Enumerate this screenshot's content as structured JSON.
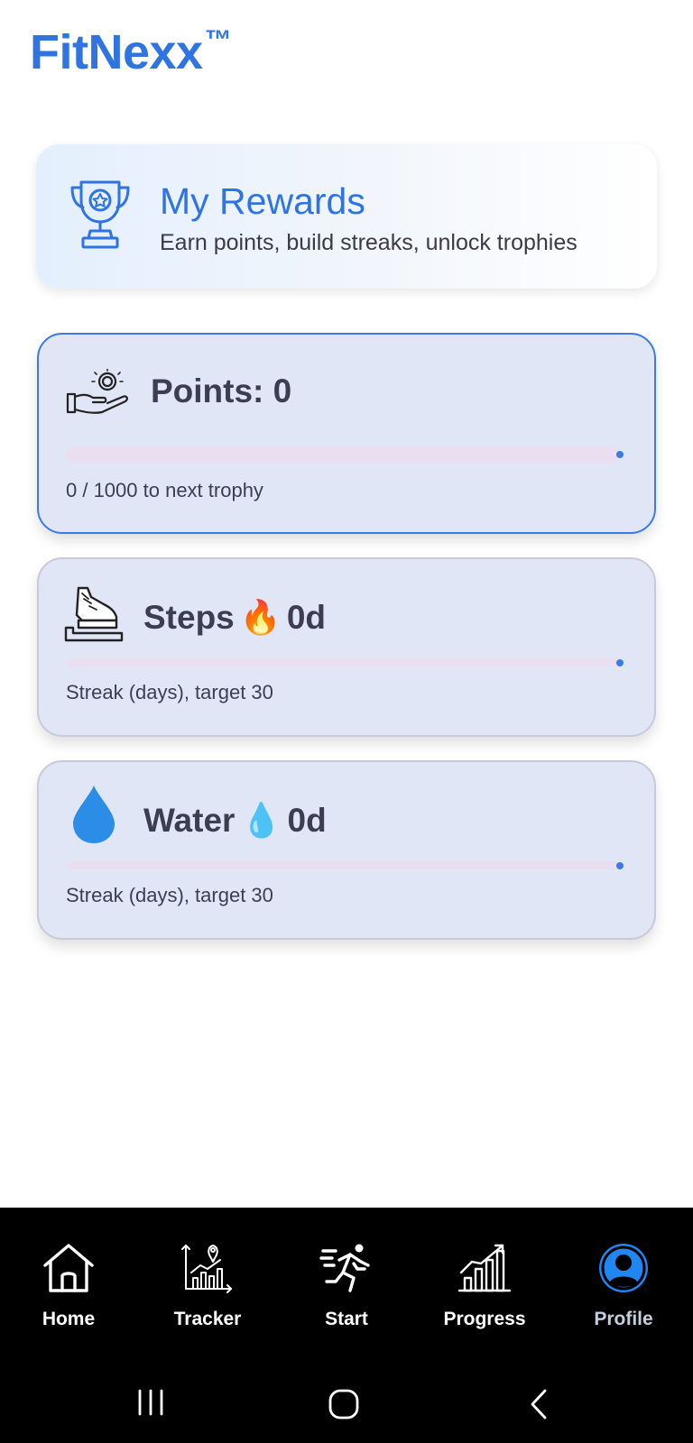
{
  "app": {
    "brand": "FitNexx",
    "trademark": "™",
    "brand_color": "#2f74e0"
  },
  "rewards": {
    "title": "My Rewards",
    "subtitle": "Earn points, build streaks, unlock trophies",
    "icon": "trophy-icon"
  },
  "cards": {
    "points": {
      "title": "Points: 0",
      "icon": "hand-coin-icon",
      "progress": 0,
      "caption": "0 / 1000 to next trophy"
    },
    "steps": {
      "label": "Steps",
      "emoji": "🔥",
      "value": "0d",
      "icon": "shoe-step-icon",
      "progress": 0,
      "caption": "Streak (days), target 30"
    },
    "water": {
      "label": "Water",
      "emoji": "💧",
      "value": "0d",
      "icon": "water-drop-icon",
      "progress": 0,
      "caption": "Streak (days), target 30"
    }
  },
  "nav": {
    "items": [
      {
        "label": "Home",
        "icon": "home-icon"
      },
      {
        "label": "Tracker",
        "icon": "tracker-icon"
      },
      {
        "label": "Start",
        "icon": "running-icon"
      },
      {
        "label": "Progress",
        "icon": "bar-chart-icon"
      },
      {
        "label": "Profile",
        "icon": "profile-icon",
        "active": true
      }
    ]
  },
  "colors": {
    "accent": "#3b7be4",
    "card_bg": "#e1e6f7",
    "track": "#e9dff1",
    "nav_bg": "#000000"
  }
}
